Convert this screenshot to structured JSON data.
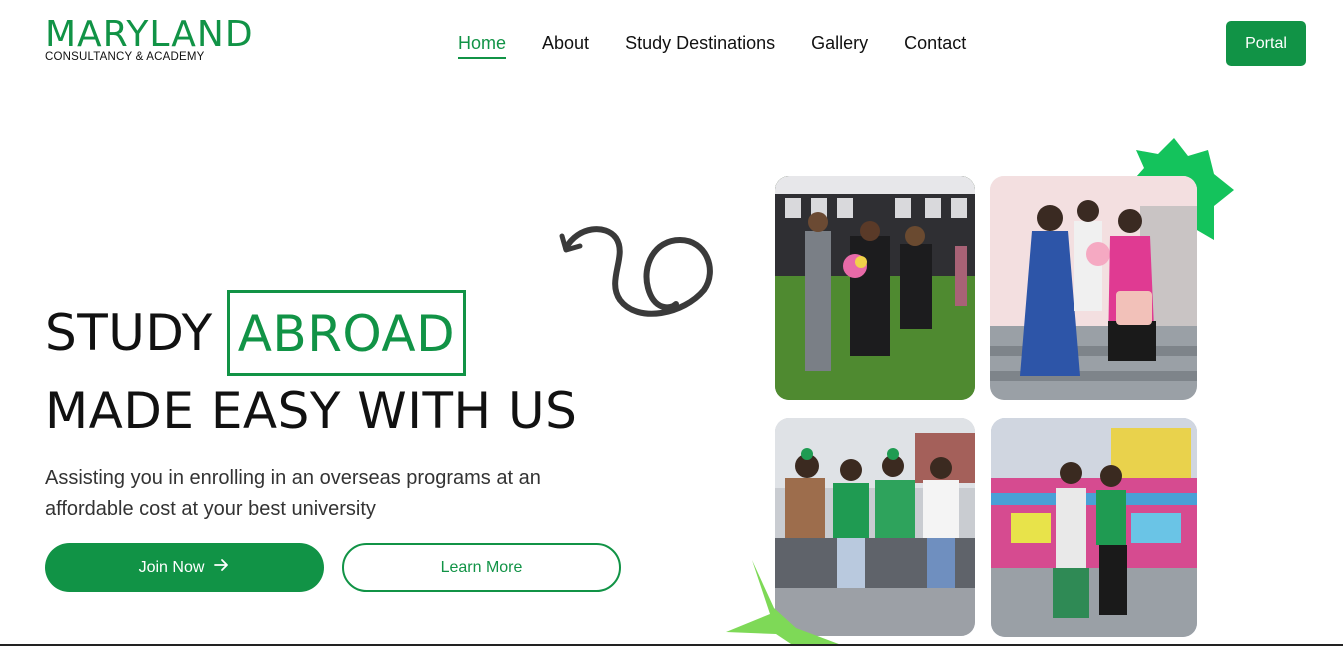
{
  "brand": {
    "name": "MARYLAND",
    "tagline": "CONSULTANCY & ACADEMY",
    "color": "#119346",
    "accent_dot_color": "#e8522a"
  },
  "nav": {
    "items": [
      {
        "label": "Home",
        "active": true
      },
      {
        "label": "About",
        "active": false
      },
      {
        "label": "Study Destinations",
        "active": false
      },
      {
        "label": "Gallery",
        "active": false
      },
      {
        "label": "Contact",
        "active": false
      }
    ],
    "portal_label": "Portal"
  },
  "hero": {
    "title_word1": "STUDY",
    "title_highlight": "ABROAD",
    "title_line2": "MADE EASY WITH US",
    "description": "Assisting you in enrolling in an overseas programs at an affordable cost at your best university",
    "join_label": "Join Now",
    "join_icon": "arrow-right-icon",
    "learn_label": "Learn More"
  },
  "gallery": {
    "photos": [
      {
        "name": "graduation-photo"
      },
      {
        "name": "family-bouquet-photo"
      },
      {
        "name": "group-sitting-photo"
      },
      {
        "name": "funfair-photo"
      }
    ]
  },
  "colors": {
    "primary": "#119346",
    "burst": "#14c35c",
    "lime_star": "#7ed957",
    "text": "#111111"
  }
}
